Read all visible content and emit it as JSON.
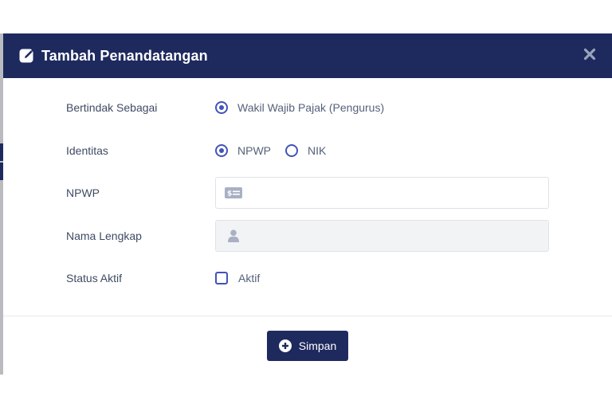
{
  "modal": {
    "title": "Tambah Penandatangan",
    "icons": {
      "title_icon": "edit-icon",
      "close": "close-icon"
    }
  },
  "form": {
    "acting_as": {
      "label": "Bertindak Sebagai",
      "options": [
        {
          "label": "Wakil Wajib Pajak (Pengurus)",
          "selected": true
        }
      ]
    },
    "identity": {
      "label": "Identitas",
      "options": [
        {
          "label": "NPWP",
          "selected": true
        },
        {
          "label": "NIK",
          "selected": false
        }
      ]
    },
    "npwp": {
      "label": "NPWP",
      "value": "",
      "placeholder": "",
      "icon": "id-card-icon"
    },
    "full_name": {
      "label": "Nama Lengkap",
      "value": "",
      "placeholder": "",
      "icon": "user-icon",
      "disabled": true
    },
    "status": {
      "label": "Status Aktif",
      "checkbox_label": "Aktif",
      "checked": false
    }
  },
  "footer": {
    "save_label": "Simpan",
    "save_icon": "plus-circle-icon"
  },
  "colors": {
    "header_bg": "#1e2a5e",
    "accent": "#4253b8",
    "label": "#3f4b63",
    "text": "#55627a"
  }
}
